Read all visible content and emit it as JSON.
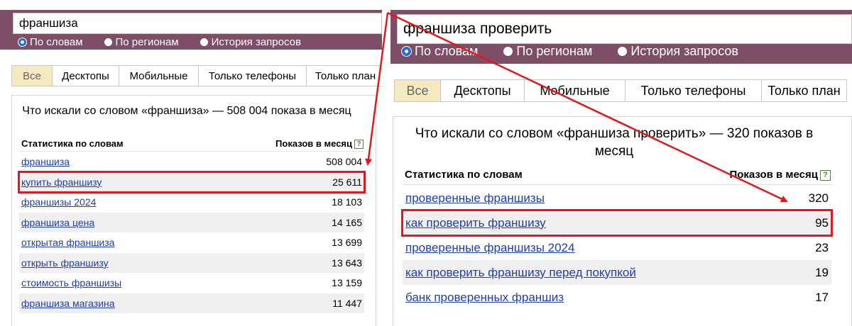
{
  "left": {
    "search_value": "франшиза",
    "radios": [
      {
        "label": "По словам",
        "checked": true
      },
      {
        "label": "По регионам",
        "checked": false
      },
      {
        "label": "История запросов",
        "checked": false
      }
    ],
    "tabs": [
      "Все",
      "Десктопы",
      "Мобильные",
      "Только телефоны",
      "Только план"
    ],
    "active_tab": "Все",
    "title": "Что искали со словом «франшиза» — 508 004 показа в месяц",
    "col_phrase": "Статистика по словам",
    "col_count": "Показов в месяц",
    "help_icon": "?",
    "rows": [
      {
        "phrase": "франшиза",
        "count": "508 004"
      },
      {
        "phrase": "купить франшизу",
        "count": "25 611"
      },
      {
        "phrase": "франшизы 2024",
        "count": "18 103"
      },
      {
        "phrase": "франшиза цена",
        "count": "14 165"
      },
      {
        "phrase": "открытая франшиза",
        "count": "13 699"
      },
      {
        "phrase": "открыть франшизу",
        "count": "13 643"
      },
      {
        "phrase": "стоимость франшизы",
        "count": "13 159"
      },
      {
        "phrase": "франшиза магазина",
        "count": "11 447"
      }
    ],
    "highlighted_row": 1
  },
  "right": {
    "search_value": "франшиза проверить",
    "radios": [
      {
        "label": "По словам",
        "checked": true
      },
      {
        "label": "По регионам",
        "checked": false
      },
      {
        "label": "История запросов",
        "checked": false
      }
    ],
    "tabs": [
      "Все",
      "Десктопы",
      "Мобильные",
      "Только телефоны",
      "Только план"
    ],
    "active_tab": "Все",
    "title": "Что искали со словом «франшиза проверить» — 320 показов в месяц",
    "col_phrase": "Статистика по словам",
    "col_count": "Показов в месяц",
    "help_icon": "?",
    "rows": [
      {
        "phrase": "проверенные франшизы",
        "count": "320"
      },
      {
        "phrase": "как проверить франшизу",
        "count": "95"
      },
      {
        "phrase": "проверенные франшизы 2024",
        "count": "23"
      },
      {
        "phrase": "как проверить франшизу перед покупкой",
        "count": "19"
      },
      {
        "phrase": "банк проверенных франшиз",
        "count": "17"
      }
    ],
    "highlighted_row": 1
  },
  "colors": {
    "header_bar": "#7e4e66",
    "active_tab": "#f4e9bf",
    "link": "#1f3fa6",
    "highlight": "#e0191f",
    "help_icon": "#4b8a2f"
  }
}
